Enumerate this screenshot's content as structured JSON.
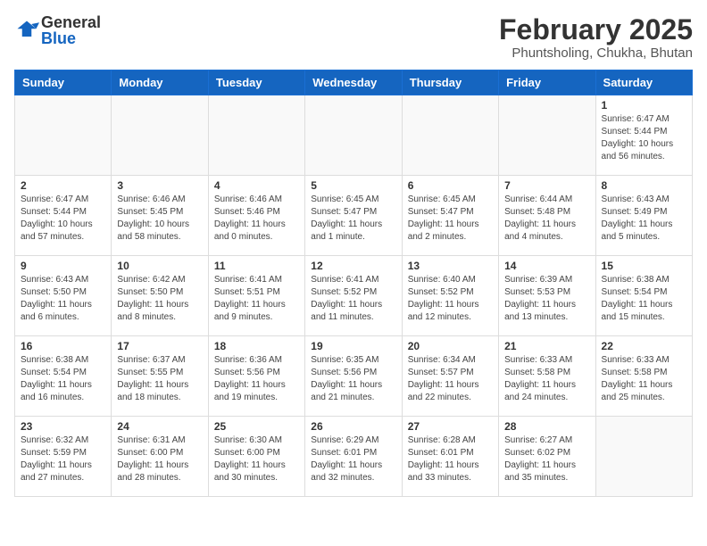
{
  "header": {
    "logo_general": "General",
    "logo_blue": "Blue",
    "month": "February 2025",
    "location": "Phuntsholing, Chukha, Bhutan"
  },
  "weekdays": [
    "Sunday",
    "Monday",
    "Tuesday",
    "Wednesday",
    "Thursday",
    "Friday",
    "Saturday"
  ],
  "weeks": [
    [
      {
        "day": "",
        "info": ""
      },
      {
        "day": "",
        "info": ""
      },
      {
        "day": "",
        "info": ""
      },
      {
        "day": "",
        "info": ""
      },
      {
        "day": "",
        "info": ""
      },
      {
        "day": "",
        "info": ""
      },
      {
        "day": "1",
        "info": "Sunrise: 6:47 AM\nSunset: 5:44 PM\nDaylight: 10 hours\nand 56 minutes."
      }
    ],
    [
      {
        "day": "2",
        "info": "Sunrise: 6:47 AM\nSunset: 5:44 PM\nDaylight: 10 hours\nand 57 minutes."
      },
      {
        "day": "3",
        "info": "Sunrise: 6:46 AM\nSunset: 5:45 PM\nDaylight: 10 hours\nand 58 minutes."
      },
      {
        "day": "4",
        "info": "Sunrise: 6:46 AM\nSunset: 5:46 PM\nDaylight: 11 hours\nand 0 minutes."
      },
      {
        "day": "5",
        "info": "Sunrise: 6:45 AM\nSunset: 5:47 PM\nDaylight: 11 hours\nand 1 minute."
      },
      {
        "day": "6",
        "info": "Sunrise: 6:45 AM\nSunset: 5:47 PM\nDaylight: 11 hours\nand 2 minutes."
      },
      {
        "day": "7",
        "info": "Sunrise: 6:44 AM\nSunset: 5:48 PM\nDaylight: 11 hours\nand 4 minutes."
      },
      {
        "day": "8",
        "info": "Sunrise: 6:43 AM\nSunset: 5:49 PM\nDaylight: 11 hours\nand 5 minutes."
      }
    ],
    [
      {
        "day": "9",
        "info": "Sunrise: 6:43 AM\nSunset: 5:50 PM\nDaylight: 11 hours\nand 6 minutes."
      },
      {
        "day": "10",
        "info": "Sunrise: 6:42 AM\nSunset: 5:50 PM\nDaylight: 11 hours\nand 8 minutes."
      },
      {
        "day": "11",
        "info": "Sunrise: 6:41 AM\nSunset: 5:51 PM\nDaylight: 11 hours\nand 9 minutes."
      },
      {
        "day": "12",
        "info": "Sunrise: 6:41 AM\nSunset: 5:52 PM\nDaylight: 11 hours\nand 11 minutes."
      },
      {
        "day": "13",
        "info": "Sunrise: 6:40 AM\nSunset: 5:52 PM\nDaylight: 11 hours\nand 12 minutes."
      },
      {
        "day": "14",
        "info": "Sunrise: 6:39 AM\nSunset: 5:53 PM\nDaylight: 11 hours\nand 13 minutes."
      },
      {
        "day": "15",
        "info": "Sunrise: 6:38 AM\nSunset: 5:54 PM\nDaylight: 11 hours\nand 15 minutes."
      }
    ],
    [
      {
        "day": "16",
        "info": "Sunrise: 6:38 AM\nSunset: 5:54 PM\nDaylight: 11 hours\nand 16 minutes."
      },
      {
        "day": "17",
        "info": "Sunrise: 6:37 AM\nSunset: 5:55 PM\nDaylight: 11 hours\nand 18 minutes."
      },
      {
        "day": "18",
        "info": "Sunrise: 6:36 AM\nSunset: 5:56 PM\nDaylight: 11 hours\nand 19 minutes."
      },
      {
        "day": "19",
        "info": "Sunrise: 6:35 AM\nSunset: 5:56 PM\nDaylight: 11 hours\nand 21 minutes."
      },
      {
        "day": "20",
        "info": "Sunrise: 6:34 AM\nSunset: 5:57 PM\nDaylight: 11 hours\nand 22 minutes."
      },
      {
        "day": "21",
        "info": "Sunrise: 6:33 AM\nSunset: 5:58 PM\nDaylight: 11 hours\nand 24 minutes."
      },
      {
        "day": "22",
        "info": "Sunrise: 6:33 AM\nSunset: 5:58 PM\nDaylight: 11 hours\nand 25 minutes."
      }
    ],
    [
      {
        "day": "23",
        "info": "Sunrise: 6:32 AM\nSunset: 5:59 PM\nDaylight: 11 hours\nand 27 minutes."
      },
      {
        "day": "24",
        "info": "Sunrise: 6:31 AM\nSunset: 6:00 PM\nDaylight: 11 hours\nand 28 minutes."
      },
      {
        "day": "25",
        "info": "Sunrise: 6:30 AM\nSunset: 6:00 PM\nDaylight: 11 hours\nand 30 minutes."
      },
      {
        "day": "26",
        "info": "Sunrise: 6:29 AM\nSunset: 6:01 PM\nDaylight: 11 hours\nand 32 minutes."
      },
      {
        "day": "27",
        "info": "Sunrise: 6:28 AM\nSunset: 6:01 PM\nDaylight: 11 hours\nand 33 minutes."
      },
      {
        "day": "28",
        "info": "Sunrise: 6:27 AM\nSunset: 6:02 PM\nDaylight: 11 hours\nand 35 minutes."
      },
      {
        "day": "",
        "info": ""
      }
    ]
  ]
}
